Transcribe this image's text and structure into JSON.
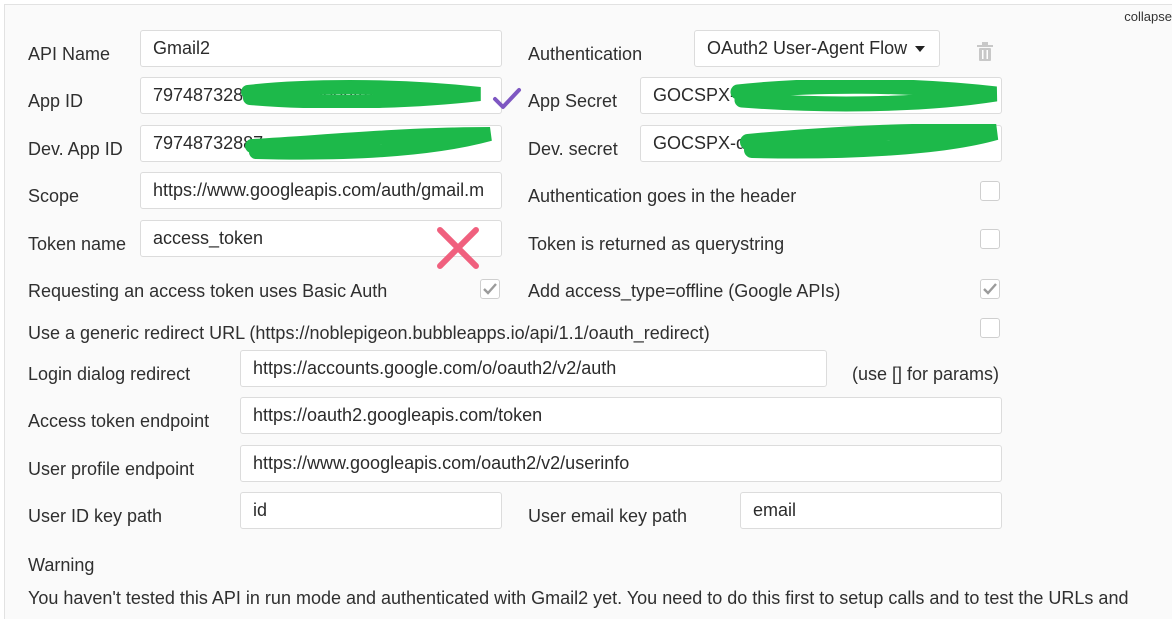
{
  "collapse_label": "collapse",
  "left_fields": {
    "api_name": {
      "label": "API Name",
      "value": "Gmail2"
    },
    "app_id": {
      "label": "App ID",
      "value": "7974873288?7 rhmidoontmi"
    },
    "dev_app_id": {
      "label": "Dev. App ID",
      "value": "79748732887"
    },
    "scope": {
      "label": "Scope",
      "value": "https://www.googleapis.com/auth/gmail.m"
    },
    "token_name": {
      "label": "Token name",
      "value": "access_token"
    }
  },
  "right_fields": {
    "authentication": {
      "label": "Authentication",
      "value": "OAuth2 User-Agent Flow"
    },
    "app_secret": {
      "label": "App Secret",
      "value": "GOCSPX-c"
    },
    "dev_secret": {
      "label": "Dev. secret",
      "value": "GOCSPX-d"
    }
  },
  "checkboxes": {
    "auth_in_header": {
      "label": "Authentication goes in the header",
      "checked": false
    },
    "token_querystring": {
      "label": "Token is returned as querystring",
      "checked": false
    },
    "basic_auth": {
      "label": "Requesting an access token uses Basic Auth",
      "checked": true
    },
    "access_type_offline": {
      "label": "Add access_type=offline (Google APIs)",
      "checked": true
    },
    "generic_redirect": {
      "label": "Use a generic redirect URL (https://noblepigeon.bubbleapps.io/api/1.1/oauth_redirect)",
      "checked": false
    }
  },
  "endpoints": {
    "login_redirect": {
      "label": "Login dialog redirect",
      "value": "https://accounts.google.com/o/oauth2/v2/auth",
      "hint": "(use [] for params)"
    },
    "access_token": {
      "label": "Access token endpoint",
      "value": "https://oauth2.googleapis.com/token"
    },
    "user_profile": {
      "label": "User profile endpoint",
      "value": "https://www.googleapis.com/oauth2/v2/userinfo"
    },
    "user_id_path": {
      "label": "User ID key path",
      "value": "id"
    },
    "user_email_path": {
      "label": "User email key path",
      "value": "email"
    }
  },
  "warning": {
    "title": "Warning",
    "text": "You haven't tested this API in run mode and authenticated with Gmail2 yet. You need to do this first to setup calls and to test the URLs and"
  },
  "annotation_colors": {
    "redaction": "#1db94a",
    "check": "#7e57c2",
    "cross": "#f0607e"
  }
}
